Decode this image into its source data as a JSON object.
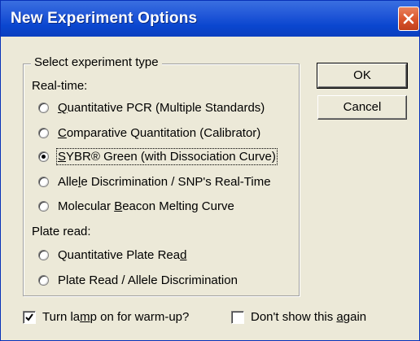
{
  "window": {
    "title": "New Experiment Options",
    "close_icon": "close-x-icon",
    "titlebar_color": "#0a46cf",
    "close_color": "#d9532a"
  },
  "group": {
    "legend": "Select experiment type",
    "realtime_label": "Real-time:",
    "plateread_label": "Plate read:"
  },
  "options": [
    {
      "pre": "",
      "key": "Q",
      "post": "uantitative PCR (Multiple Standards)",
      "selected": false
    },
    {
      "pre": "",
      "key": "C",
      "post": "omparative Quantitation (Calibrator)",
      "selected": false
    },
    {
      "pre": "",
      "key": "S",
      "post": "YBR® Green (with Dissociation Curve)",
      "selected": true
    },
    {
      "pre": "Alle",
      "key": "l",
      "post": "e Discrimination / SNP's Real-Time",
      "selected": false
    },
    {
      "pre": "Molecular ",
      "key": "B",
      "post": "eacon Melting Curve",
      "selected": false
    },
    {
      "pre": "Quantitative Plate Rea",
      "key": "d",
      "post": "",
      "selected": false
    },
    {
      "pre": "Plate Read / Allele Discrimination",
      "key": "",
      "post": "",
      "selected": false
    }
  ],
  "buttons": {
    "ok": "OK",
    "cancel": "Cancel"
  },
  "checkboxes": {
    "lamp": {
      "pre": "Turn la",
      "key": "m",
      "post": "p on for warm-up?",
      "checked": true
    },
    "dontshow": {
      "pre": "Don't show this ",
      "key": "a",
      "post": "gain",
      "checked": false
    }
  }
}
